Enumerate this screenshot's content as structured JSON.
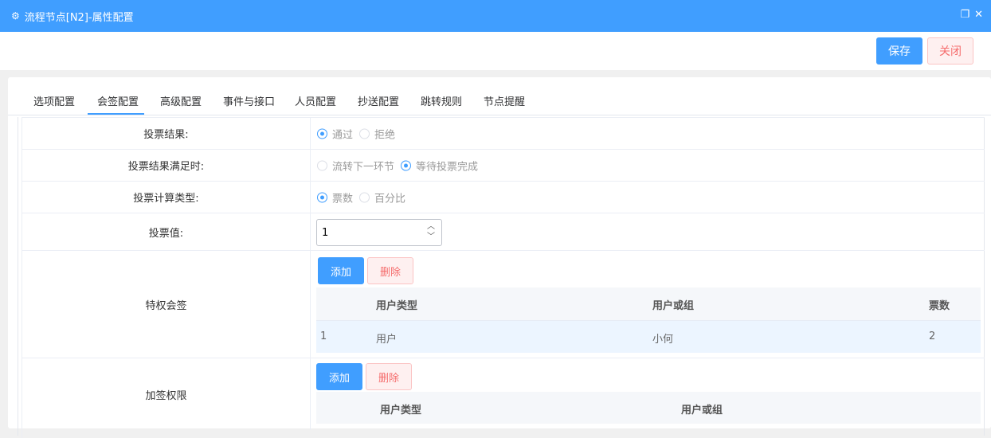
{
  "window": {
    "title": "流程节点[N2]-属性配置",
    "icon": "settings-icon"
  },
  "toolbar": {
    "save_label": "保存",
    "close_label": "关闭"
  },
  "tabs": [
    "选项配置",
    "会签配置",
    "高级配置",
    "事件与接口",
    "人员配置",
    "抄送配置",
    "跳转规则",
    "节点提醒"
  ],
  "active_tab": "会签配置",
  "form": {
    "vote_result": {
      "label": "投票结果:",
      "options": [
        "通过",
        "拒绝"
      ],
      "selected": "通过"
    },
    "vote_satisfied": {
      "label": "投票结果满足时:",
      "options": [
        "流转下一环节",
        "等待投票完成"
      ],
      "selected": "等待投票完成"
    },
    "vote_calc_type": {
      "label": "投票计算类型:",
      "options": [
        "票数",
        "百分比"
      ],
      "selected": "票数"
    },
    "vote_value": {
      "label": "投票值:",
      "value": "1"
    },
    "privileged": {
      "label": "特权会签",
      "add_label": "添加",
      "delete_label": "删除",
      "columns": [
        "用户类型",
        "用户或组",
        "票数"
      ],
      "rows": [
        {
          "index": "1",
          "user_type": "用户",
          "user_or_group": "小何",
          "votes": "2"
        }
      ]
    },
    "add_sign": {
      "label": "加签权限",
      "add_label": "添加",
      "delete_label": "删除",
      "columns": [
        "用户类型",
        "用户或组"
      ]
    }
  }
}
